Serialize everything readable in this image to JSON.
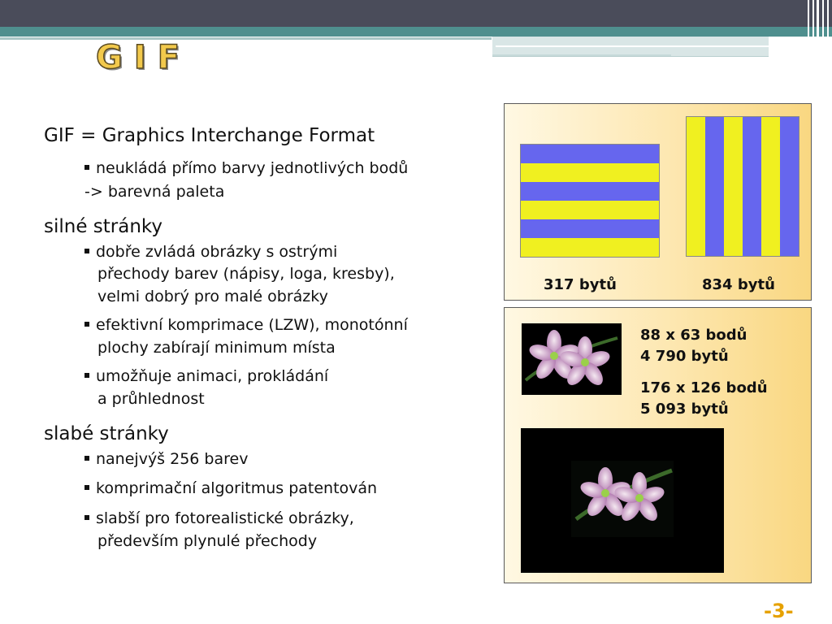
{
  "slide": {
    "title": "GIF",
    "heading": "GIF = Graphics Interchange Format",
    "intro_bullet": [
      "neukládá přímo barvy jednotlivých bodů",
      "-> barevná paleta"
    ],
    "strengths": {
      "heading": "silné stránky",
      "bullets": [
        [
          "dobře zvládá obrázky s ostrými",
          "přechody barev (nápisy, loga, kresby),",
          "velmi dobrý pro malé obrázky"
        ],
        [
          "efektivní komprimace (LZW), monotónní",
          "plochy zabírají minimum místa"
        ],
        [
          "umožňuje animaci, prokládání",
          "a průhlednost"
        ]
      ]
    },
    "weaknesses": {
      "heading": "slabé stránky",
      "bullets": [
        [
          "nanejvýš 256 barev"
        ],
        [
          "komprimační algoritmus patentován"
        ],
        [
          "slabší pro fotorealistické obrázky,",
          "především plynulé přechody"
        ]
      ]
    },
    "page_number": "-3-"
  },
  "examples": {
    "stripes": {
      "horizontal_caption": "317 bytů",
      "vertical_caption": "834 bytů",
      "colors": {
        "blue": "#6666ee",
        "yellow": "#f0f020"
      }
    },
    "photos": {
      "small": [
        "88 x 63 bodů",
        "4 790 bytů"
      ],
      "large": [
        "176 x 126 bodů",
        "5 093 bytů"
      ]
    }
  },
  "colors": {
    "accent": "#e6a100",
    "teal": "#4f8f8e",
    "topbar": "#4a4c5a"
  }
}
